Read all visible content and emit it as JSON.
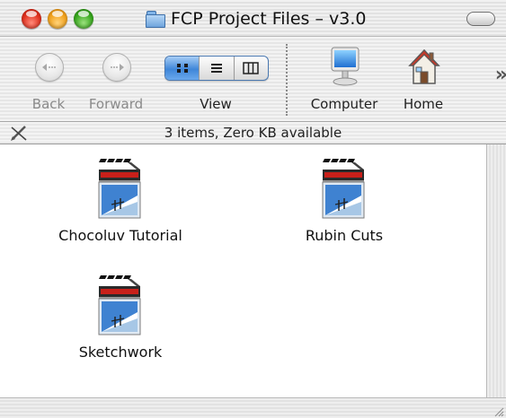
{
  "window": {
    "title": "FCP Project Files – v3.0"
  },
  "toolbar": {
    "back_label": "Back",
    "forward_label": "Forward",
    "view_label": "View",
    "computer_label": "Computer",
    "home_label": "Home",
    "view_modes": [
      "icon",
      "list",
      "column"
    ],
    "selected_view": "icon"
  },
  "status": {
    "text": "3 items, Zero KB available"
  },
  "files": [
    {
      "name": "Chocoluv Tutorial",
      "icon": "fcp-project-icon"
    },
    {
      "name": "Rubin Cuts",
      "icon": "fcp-project-icon"
    },
    {
      "name": "Sketchwork",
      "icon": "fcp-project-icon"
    }
  ],
  "colors": {
    "close": "#e0301e",
    "minimize": "#f1a11c",
    "zoom": "#38a81e",
    "selection_blue": "#3f86d8"
  }
}
